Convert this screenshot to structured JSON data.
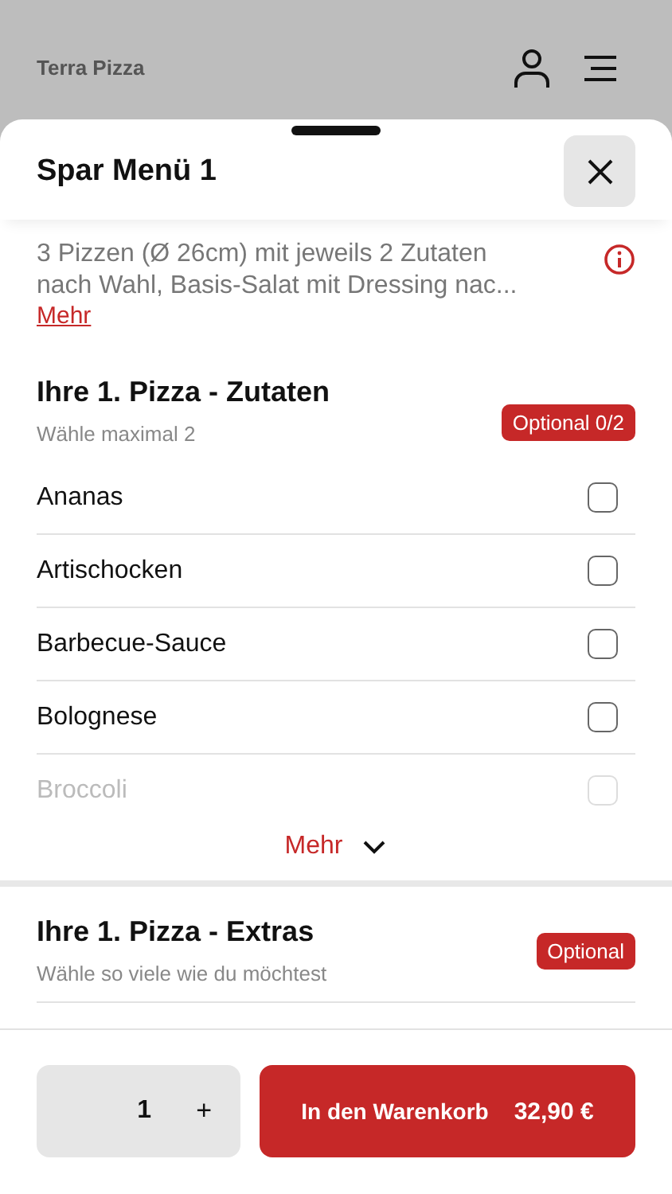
{
  "app_bar": {
    "title": "Terra Pizza"
  },
  "sheet": {
    "title": "Spar Menü 1",
    "description": "3 Pizzen (Ø 26cm) mit jeweils 2 Zutaten nach Wahl, Basis-Salat mit Dressing nac...",
    "more_link": "Mehr"
  },
  "sections": [
    {
      "title": "Ihre 1. Pizza - Zutaten",
      "subtitle": "Wähle maximal 2",
      "badge": "Optional 0/2",
      "options": [
        {
          "label": "Ananas",
          "checked": false,
          "faded": false
        },
        {
          "label": "Artischocken",
          "checked": false,
          "faded": false
        },
        {
          "label": "Barbecue-Sauce",
          "checked": false,
          "faded": false
        },
        {
          "label": "Bolognese",
          "checked": false,
          "faded": false
        },
        {
          "label": "Broccoli",
          "checked": false,
          "faded": true
        }
      ],
      "show_more": "Mehr"
    },
    {
      "title": "Ihre 1. Pizza - Extras",
      "subtitle": "Wähle so viele wie du möchtest",
      "badge": "Optional"
    }
  ],
  "footer": {
    "quantity": "1",
    "plus": "+",
    "cart_button": "In den Warenkorb",
    "price": "32,90 €"
  }
}
